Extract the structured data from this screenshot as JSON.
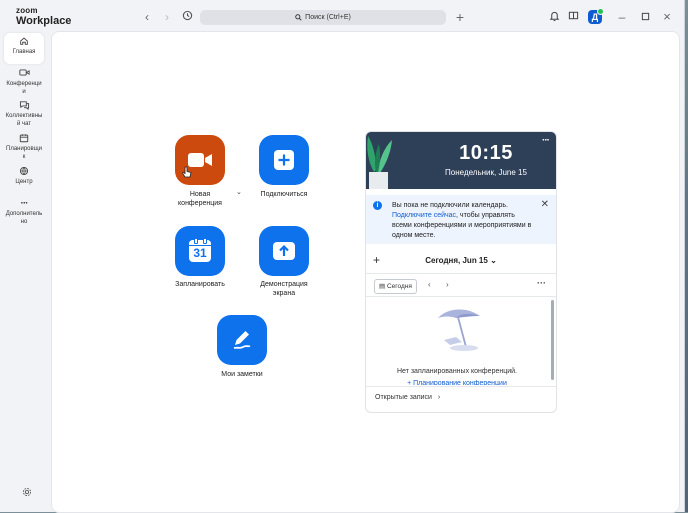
{
  "app": {
    "brand_small": "zoom",
    "brand_large": "Workplace"
  },
  "search": {
    "placeholder": "Поиск (Ctrl+E)"
  },
  "user": {
    "avatar_letter": "Д"
  },
  "sidebar": {
    "items": [
      {
        "label": "Главная",
        "icon": "home-icon"
      },
      {
        "label": "Конференци и",
        "icon": "video-icon"
      },
      {
        "label": "Коллективны й чат",
        "icon": "chat-icon"
      },
      {
        "label": "Планировщи к",
        "icon": "calendar-icon"
      },
      {
        "label": "Центр",
        "icon": "hub-icon"
      },
      {
        "label": "Дополнитель но",
        "icon": "more-icon"
      }
    ]
  },
  "actions": {
    "new_meeting": {
      "label": "Новая конференция",
      "color": "#cc4a0e"
    },
    "join": {
      "label": "Подключиться",
      "color": "#0e72ed"
    },
    "schedule": {
      "label": "Запланировать",
      "day": "31"
    },
    "share": {
      "label": "Демонстрация экрана"
    },
    "notes": {
      "label": "Мои заметки"
    }
  },
  "calendar": {
    "time": "10:15",
    "date": "Понедельник, June 15",
    "notice_text": "Вы пока не подключили календарь.",
    "notice_link": "Подключите сейчас",
    "notice_rest": ", чтобы управлять всеми конференциями и мероприятиями в одном месте.",
    "day_title": "Сегодня, Jun 15",
    "today_button": "Сегодня",
    "empty_text": "Нет запланированных конференций.",
    "plan_link": "+ Планирование конференции",
    "recordings": "Открытые записи"
  }
}
